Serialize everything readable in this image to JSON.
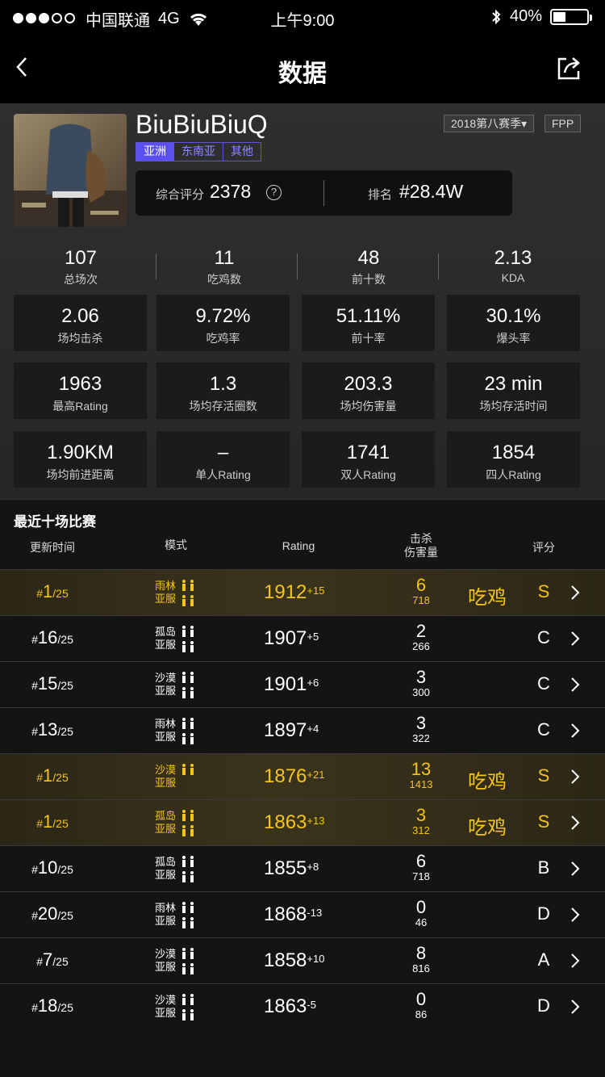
{
  "status_bar": {
    "carrier": "中国联通",
    "network": "4G",
    "time": "上午9:00",
    "battery": "40%",
    "battery_level": 0.4
  },
  "nav": {
    "title": "数据"
  },
  "profile": {
    "username": "BiuBiuBiuQ",
    "regions": [
      "亚洲",
      "东南亚",
      "其他"
    ],
    "season": "2018第八赛季▾",
    "mode": "FPP",
    "score_label": "综合评分",
    "score_value": "2378",
    "rank_label": "排名",
    "rank_value": "#28.4W"
  },
  "top_stats": [
    {
      "value": "107",
      "label": "总场次"
    },
    {
      "value": "11",
      "label": "吃鸡数"
    },
    {
      "value": "48",
      "label": "前十数"
    },
    {
      "value": "2.13",
      "label": "KDA"
    }
  ],
  "cards": [
    {
      "value": "2.06",
      "label": "场均击杀"
    },
    {
      "value": "9.72%",
      "label": "吃鸡率"
    },
    {
      "value": "51.11%",
      "label": "前十率"
    },
    {
      "value": "30.1%",
      "label": "爆头率"
    },
    {
      "value": "1963",
      "label": "最高Rating"
    },
    {
      "value": "1.3",
      "label": "场均存活圈数"
    },
    {
      "value": "203.3",
      "label": "场均伤害量"
    },
    {
      "value": "23 min",
      "label": "场均存活时间"
    },
    {
      "value": "1.90KM",
      "label": "场均前进距离"
    },
    {
      "value": "–",
      "label": "单人Rating"
    },
    {
      "value": "1741",
      "label": "双人Rating"
    },
    {
      "value": "1854",
      "label": "四人Rating"
    }
  ],
  "recent": {
    "title": "最近十场比赛",
    "headers": {
      "time": "更新时间",
      "mode": "模式",
      "rating": "Rating",
      "kills": "击杀",
      "damage": "伤害量",
      "grade": "评分"
    },
    "matches": [
      {
        "rank": "1",
        "total": "/25",
        "map": "雨林",
        "server": "亚服",
        "figs1": "🯅🯅",
        "figs2": "🯅🯅",
        "rating": "1912",
        "delta": "+15",
        "kills": "6",
        "damage": "718",
        "chicken": "吃鸡",
        "grade": "S",
        "win": true
      },
      {
        "rank": "16",
        "total": "/25",
        "map": "孤岛",
        "server": "亚服",
        "figs1": "🯅🯅",
        "figs2": "🯅🯅",
        "rating": "1907",
        "delta": "+5",
        "kills": "2",
        "damage": "266",
        "chicken": "",
        "grade": "C",
        "win": false
      },
      {
        "rank": "15",
        "total": "/25",
        "map": "沙漠",
        "server": "亚服",
        "figs1": "🯅🯅",
        "figs2": "🯅🯅",
        "rating": "1901",
        "delta": "+6",
        "kills": "3",
        "damage": "300",
        "chicken": "",
        "grade": "C",
        "win": false
      },
      {
        "rank": "13",
        "total": "/25",
        "map": "雨林",
        "server": "亚服",
        "figs1": "🯅🯅",
        "figs2": "🯅🯅",
        "rating": "1897",
        "delta": "+4",
        "kills": "3",
        "damage": "322",
        "chicken": "",
        "grade": "C",
        "win": false
      },
      {
        "rank": "1",
        "total": "/25",
        "map": "沙漠",
        "server": "亚服",
        "figs1": "🯅🯅",
        "figs2": "",
        "rating": "1876",
        "delta": "+21",
        "kills": "13",
        "damage": "1413",
        "chicken": "吃鸡",
        "grade": "S",
        "win": true
      },
      {
        "rank": "1",
        "total": "/25",
        "map": "孤岛",
        "server": "亚服",
        "figs1": "🯅🯅",
        "figs2": "🯅🯅",
        "rating": "1863",
        "delta": "+13",
        "kills": "3",
        "damage": "312",
        "chicken": "吃鸡",
        "grade": "S",
        "win": true
      },
      {
        "rank": "10",
        "total": "/25",
        "map": "孤岛",
        "server": "亚服",
        "figs1": "🯅🯅",
        "figs2": "🯅🯅",
        "rating": "1855",
        "delta": "+8",
        "kills": "6",
        "damage": "718",
        "chicken": "",
        "grade": "B",
        "win": false
      },
      {
        "rank": "20",
        "total": "/25",
        "map": "雨林",
        "server": "亚服",
        "figs1": "🯅🯅",
        "figs2": "🯅🯅",
        "rating": "1868",
        "delta": "-13",
        "kills": "0",
        "damage": "46",
        "chicken": "",
        "grade": "D",
        "win": false
      },
      {
        "rank": "7",
        "total": "/25",
        "map": "沙漠",
        "server": "亚服",
        "figs1": "🯅🯅",
        "figs2": "🯅🯅",
        "rating": "1858",
        "delta": "+10",
        "kills": "8",
        "damage": "816",
        "chicken": "",
        "grade": "A",
        "win": false
      },
      {
        "rank": "18",
        "total": "/25",
        "map": "沙漠",
        "server": "亚服",
        "figs1": "🯅🯅",
        "figs2": "🯅🯅",
        "rating": "1863",
        "delta": "-5",
        "kills": "0",
        "damage": "86",
        "chicken": "",
        "grade": "D",
        "win": false
      }
    ]
  },
  "colors": {
    "accent": "#f5c518",
    "region_active": "#5c4ff0"
  }
}
